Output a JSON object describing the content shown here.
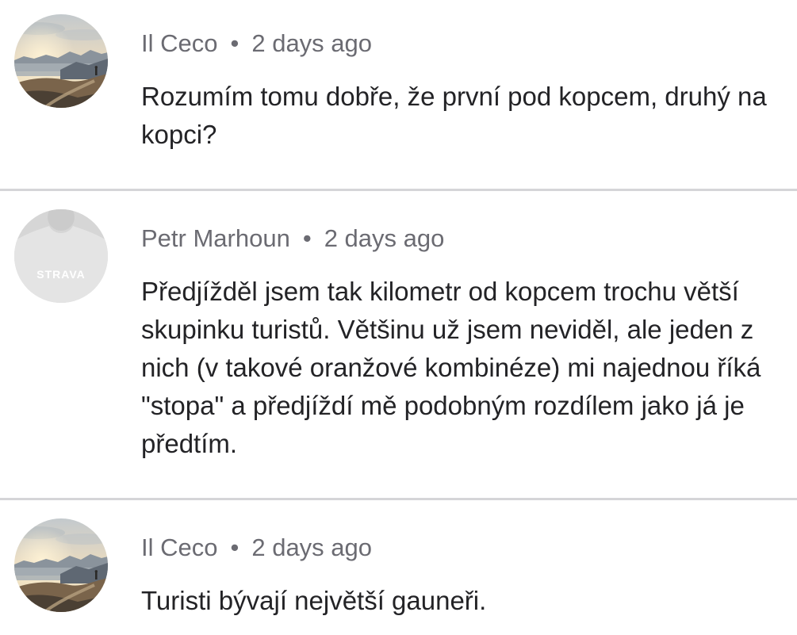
{
  "separator": "•",
  "colors": {
    "background": "#ffffff",
    "text": "#232326",
    "meta": "#6b6b72",
    "divider": "#d5d5d8"
  },
  "comments": [
    {
      "author": "Il Ceco",
      "time": "2 days ago",
      "text": "Rozumím tomu dobře, že první pod kopcem, druhý na kopci?",
      "avatar": "landscape-photo-avatar"
    },
    {
      "author": "Petr Marhoun",
      "time": "2 days ago",
      "text": "Předjížděl jsem tak kilometr od kopcem trochu větší skupinku turistů. Většinu už jsem neviděl, ale jeden z nich (v takové oranžové kombinéze) mi najednou říká \"stopa\" a předjíždí mě podobným rozdílem jako já je předtím.",
      "avatar": "strava-default-avatar",
      "avatar_logo_text": "STRAVA"
    },
    {
      "author": "Il Ceco",
      "time": "2 days ago",
      "text": "Turisti bývají největší gauneři.",
      "avatar": "landscape-photo-avatar"
    }
  ]
}
